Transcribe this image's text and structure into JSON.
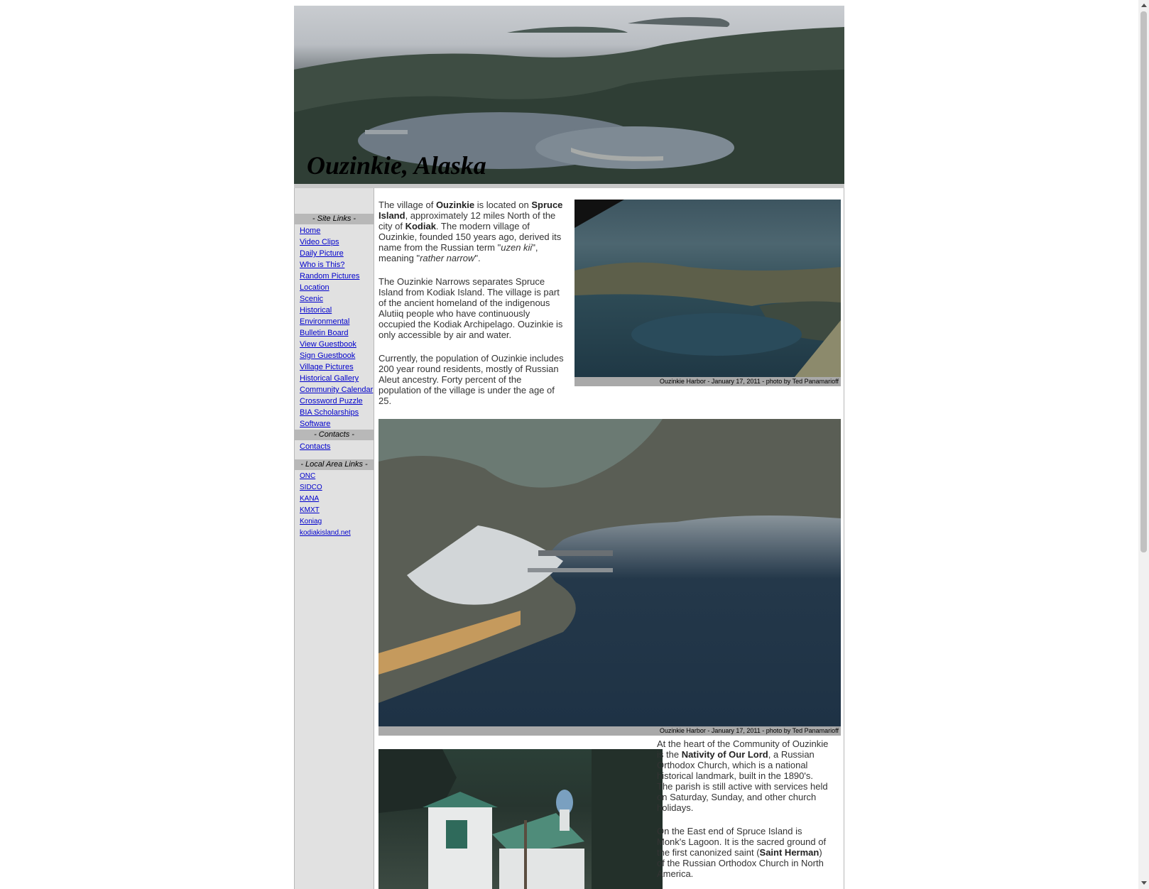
{
  "header": {
    "title": "Ouzinkie, Alaska"
  },
  "sidebar": {
    "site_links_heading": "- Site Links -",
    "site_links": [
      "Home",
      "Video Clips",
      "Daily Picture",
      "Who is This?",
      "Random Pictures",
      "Location",
      "Scenic",
      "Historical",
      "Environmental",
      "Bulletin Board",
      "View Guestbook",
      "Sign Guestbook",
      "Village Pictures",
      "Historical Gallery",
      "Community Calendar",
      "Crossword Puzzle",
      "BIA Scholarships",
      "Software"
    ],
    "contacts_heading": "- Contacts -",
    "contacts_link": "Contacts",
    "local_links_heading": "- Local Area Links -",
    "local_links": [
      "ONC",
      "SIDCO",
      "KANA",
      "KMXT",
      "Koniag",
      "kodiakisland.net"
    ]
  },
  "main": {
    "para1": {
      "t1": "The village of ",
      "b1": "Ouzinkie",
      "t2": " is located on ",
      "b2": "Spruce Island",
      "t3": ", approximately 12 miles North of the city of ",
      "b3": "Kodiak",
      "t4": ". The modern village of Ouzinkie, founded 150 years ago, derived its name from the Russian term \"",
      "i1": "uzen kii",
      "t5": "\", meaning \"",
      "i2": "rather narrow",
      "t6": "\"."
    },
    "para2": "The Ouzinkie Narrows separates Spruce Island from Kodiak Island. The village is part of the ancient homeland of the indigenous Alutiiq people who have continuously occupied the Kodiak Archipelago. Ouzinkie is only accessible by air and water.",
    "para3": "Currently, the population of Ouzinkie includes 200 year round residents, mostly of Russian Aleut ancestry. Forty percent of the population of the village is under the age of 25.",
    "photo1_caption": "Ouzinkie Harbor - January 17, 2011 - photo by Ted Panamarioff",
    "photo2_caption": "Ouzinkie Harbor - January 17, 2011 - photo by Ted Panamarioff",
    "para4": {
      "t1": "At the heart of the Community of Ouzinkie is the ",
      "b1": "Nativity of Our Lord",
      "t2": ", a Russian Orthodox Church, which is a national historical landmark, built in the 1890's. The parish is still active with services held on Saturday, Sunday, and other church holidays."
    },
    "para5": {
      "t1": "On the East end of Spruce Island is Monk's Lagoon. It is the sacred ground of the first canonized saint (",
      "b1": "Saint Herman",
      "t2": ") of the Russian Orthodox Church in North America."
    }
  }
}
